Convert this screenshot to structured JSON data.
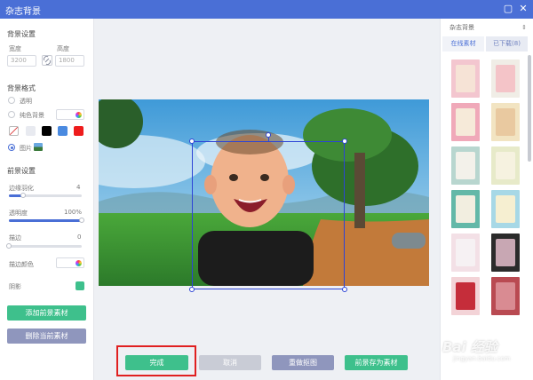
{
  "window": {
    "title": "杂志背景"
  },
  "left_panel": {
    "background_settings": {
      "title": "背景设置",
      "width_label": "宽度",
      "width_value": "3200",
      "height_label": "高度",
      "height_value": "1800"
    },
    "background_format": {
      "title": "背景格式",
      "opt_transparent": "透明",
      "opt_solid": "纯色背景",
      "opt_image": "图片",
      "swatches": [
        "#e8eaf0",
        "#ffffff",
        "#000000",
        "#4a8ae0",
        "#ee1c1c"
      ]
    },
    "foreground_settings": {
      "title": "前景设置",
      "feather_label": "边缘羽化",
      "feather_value": "4",
      "feather_fraction": 0.2,
      "opacity_label": "透明度",
      "opacity_value": "100%",
      "opacity_fraction": 1.0,
      "stroke_label": "描边",
      "stroke_value": "0",
      "stroke_fraction": 0.0,
      "stroke_color_label": "描边颜色",
      "shadow_label": "阴影"
    },
    "add_foreground_btn": "添加前景素材",
    "delete_foreground_btn": "删除当前素材"
  },
  "toolbar": {
    "done": "完成",
    "cancel": "取消",
    "reselect": "重做抠图",
    "save_foreground": "前景存为素材"
  },
  "right_panel": {
    "dropdown": "杂志背景",
    "tab_online": "在线素材",
    "tab_downloaded": "已下载(8)",
    "thumbs": [
      {
        "bg": "#f3c6cf",
        "inner": "#f6e3d6"
      },
      {
        "bg": "#f0ede6",
        "inner": "#f4c4c8"
      },
      {
        "bg": "#f0a9b9",
        "inner": "#f6ead9"
      },
      {
        "bg": "#f2e4c2",
        "inner": "#e9c9a0"
      },
      {
        "bg": "#b8d6cf",
        "inner": "#f3f1ea"
      },
      {
        "bg": "#e7eac9",
        "inner": "#f6f2e0"
      },
      {
        "bg": "#63b8a8",
        "inner": "#f2eee0"
      },
      {
        "bg": "#a7d8e6",
        "inner": "#f6efd1"
      },
      {
        "bg": "#f3e0e6",
        "inner": "#f6f1f3"
      },
      {
        "bg": "#2b2b2b",
        "inner": "#c8a7b3"
      },
      {
        "bg": "#f3d3d7",
        "inner": "#c52d3a"
      },
      {
        "bg": "#b94a52",
        "inner": "#d98b92"
      }
    ]
  },
  "watermark": {
    "text": "Bai 经验",
    "sub": "jingyan.baidu.com"
  }
}
